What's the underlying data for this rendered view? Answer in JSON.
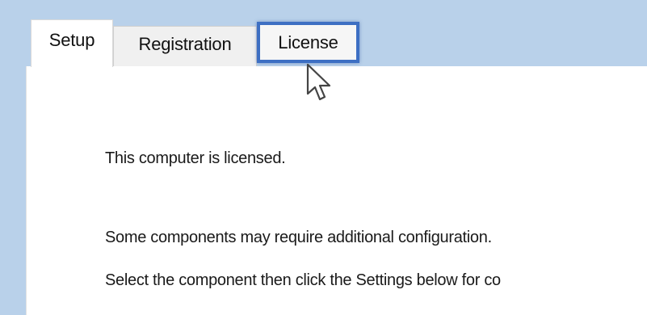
{
  "tabs": [
    {
      "label": "Setup",
      "selected": true
    },
    {
      "label": "Registration",
      "selected": false
    },
    {
      "label": "License",
      "selected": false,
      "highlighted": true
    }
  ],
  "content": {
    "status_text": "This computer is licensed.",
    "info_text": "Some components may require additional configuration.",
    "instruction_text": "Select the component then click the Settings below for co"
  },
  "icons": {
    "cursor": "mouse-pointer-icon"
  },
  "colors": {
    "tabbar_background": "#b9d1ea",
    "highlight_border": "#3d6fc3"
  }
}
